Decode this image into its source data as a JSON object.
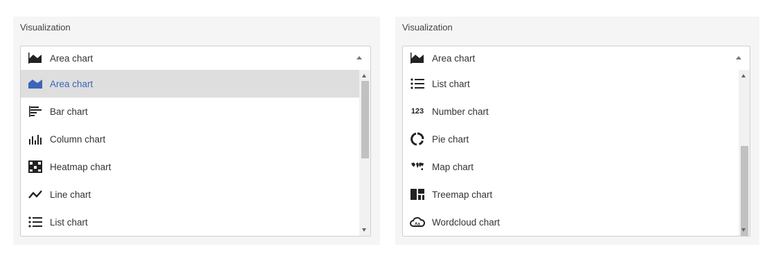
{
  "left_panel": {
    "label": "Visualization",
    "selected_value": "Area chart",
    "options": [
      "Area chart",
      "Bar chart",
      "Column chart",
      "Heatmap chart",
      "Line chart",
      "List chart"
    ],
    "highlighted": "Area chart",
    "accent_color": "#3b65b8"
  },
  "right_panel": {
    "label": "Visualization",
    "selected_value": "Area chart",
    "options": [
      "List chart",
      "Number chart",
      "Pie chart",
      "Map chart",
      "Treemap chart",
      "Wordcloud chart"
    ],
    "number_icon_text": "123"
  },
  "icons": {
    "area": "area-chart-icon",
    "bar": "bar-chart-icon",
    "column": "column-chart-icon",
    "heatmap": "heatmap-chart-icon",
    "line": "line-chart-icon",
    "list": "list-chart-icon",
    "number": "number-chart-icon",
    "pie": "pie-chart-icon",
    "map": "map-chart-icon",
    "treemap": "treemap-chart-icon",
    "wordcloud": "wordcloud-chart-icon"
  }
}
